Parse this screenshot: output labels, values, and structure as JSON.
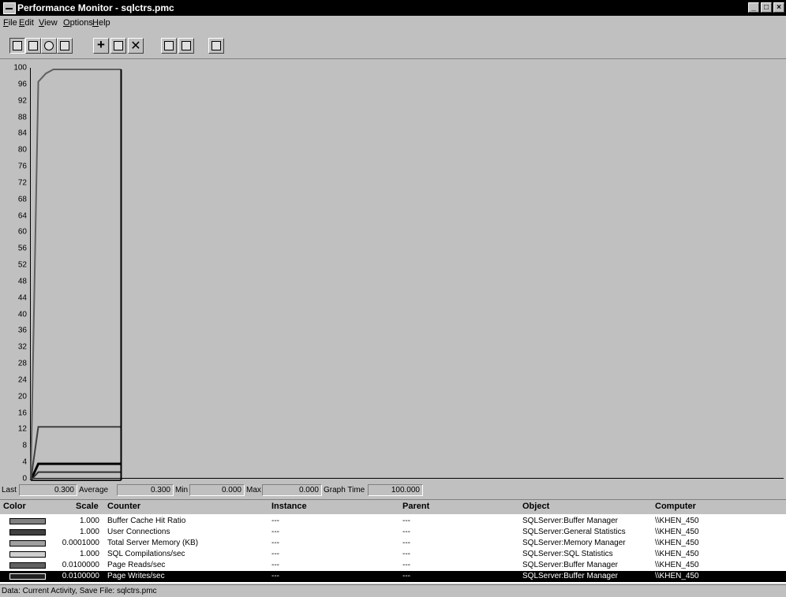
{
  "window": {
    "title": "Performance Monitor - sqlctrs.pmc",
    "buttons": [
      "_",
      "□",
      "×"
    ]
  },
  "menu": [
    "File",
    "Edit",
    "View",
    "Options",
    "Help"
  ],
  "toolbar": [
    "chart-view-icon",
    "alert-view-icon",
    "log-view-icon",
    "report-view-icon",
    "add-counter-icon",
    "edit-counter-icon",
    "delete-counter-icon",
    "update-now-icon",
    "bookmark-icon",
    "options-icon"
  ],
  "y_ticks": [
    "100",
    "96",
    "92",
    "88",
    "84",
    "80",
    "76",
    "72",
    "68",
    "64",
    "60",
    "56",
    "52",
    "48",
    "44",
    "40",
    "36",
    "32",
    "28",
    "24",
    "20",
    "16",
    "12",
    "8",
    "4",
    "0"
  ],
  "chart_data": {
    "type": "line",
    "ylim": [
      0,
      100
    ],
    "x_range": [
      0,
      100
    ],
    "series": [
      {
        "values": [
          [
            0,
            0
          ],
          [
            1,
            97
          ],
          [
            2,
            99
          ],
          [
            3,
            100
          ],
          [
            12,
            100
          ]
        ],
        "color": "#606060"
      },
      {
        "values": [
          [
            0,
            0
          ],
          [
            1,
            4
          ],
          [
            12,
            4
          ]
        ],
        "color": "#000000"
      },
      {
        "values": [
          [
            0,
            0
          ],
          [
            1,
            13
          ],
          [
            12,
            13
          ]
        ],
        "color": "#404040"
      },
      {
        "values": [
          [
            0,
            0
          ],
          [
            1,
            2
          ],
          [
            12,
            2
          ]
        ],
        "color": "#303030"
      },
      {
        "values": [
          [
            0,
            0
          ],
          [
            12,
            0
          ]
        ],
        "color": "#202020"
      }
    ]
  },
  "valuebar": {
    "last_label": "Last",
    "last": "0.300",
    "average_label": "Average",
    "average": "0.300",
    "min_label": "Min",
    "min": "0.000",
    "max_label": "Max",
    "max": "0.000",
    "graph_time_label": "Graph Time",
    "graph_time": "100.000"
  },
  "legend_headers": {
    "color": "Color",
    "scale": "Scale",
    "counter": "Counter",
    "instance": "Instance",
    "parent": "Parent",
    "object": "Object",
    "computer": "Computer"
  },
  "legend_rows": [
    {
      "scale": "1.000",
      "counter": "Buffer Cache Hit Ratio",
      "instance": "---",
      "parent": "---",
      "object": "SQLServer:Buffer Manager",
      "computer": "\\\\KHEN_450"
    },
    {
      "scale": "1.000",
      "counter": "User Connections",
      "instance": "---",
      "parent": "---",
      "object": "SQLServer:General Statistics",
      "computer": "\\\\KHEN_450"
    },
    {
      "scale": "0.0001000",
      "counter": "Total Server Memory (KB)",
      "instance": "---",
      "parent": "---",
      "object": "SQLServer:Memory Manager",
      "computer": "\\\\KHEN_450"
    },
    {
      "scale": "1.000",
      "counter": "SQL Compilations/sec",
      "instance": "---",
      "parent": "---",
      "object": "SQLServer:SQL Statistics",
      "computer": "\\\\KHEN_450"
    },
    {
      "scale": "0.0100000",
      "counter": "Page Reads/sec",
      "instance": "---",
      "parent": "---",
      "object": "SQLServer:Buffer Manager",
      "computer": "\\\\KHEN_450"
    },
    {
      "scale": "0.0100000",
      "counter": "Page Writes/sec",
      "instance": "---",
      "parent": "---",
      "object": "SQLServer:Buffer Manager",
      "computer": "\\\\KHEN_450"
    }
  ],
  "status": "Data: Current Activity, Save File: sqlctrs.pmc"
}
